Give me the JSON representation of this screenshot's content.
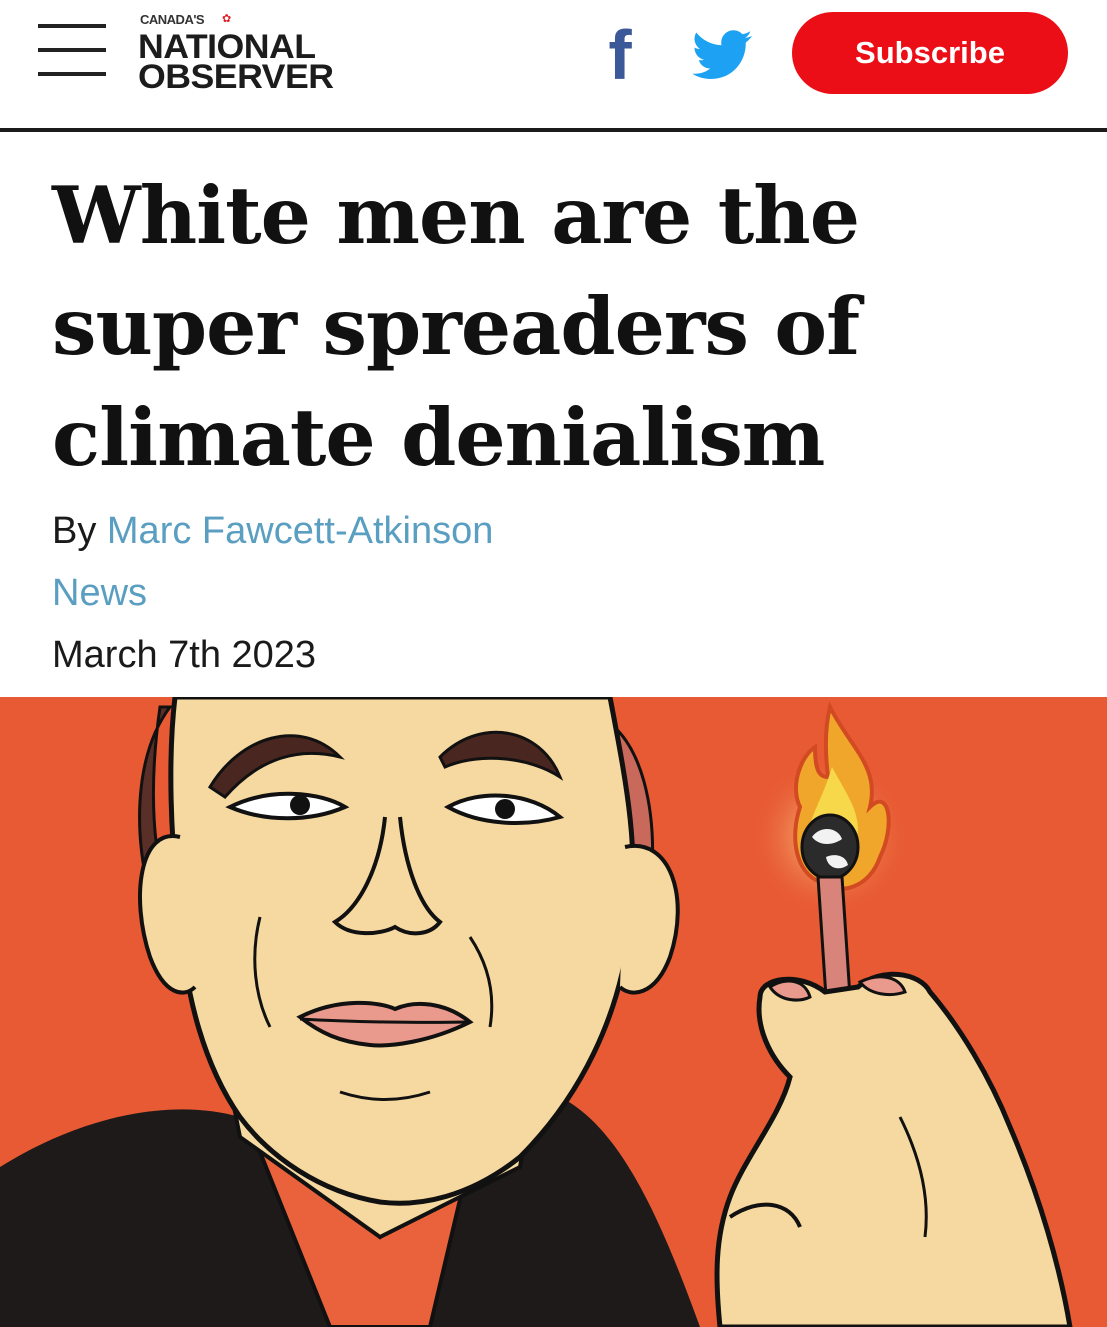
{
  "header": {
    "logo_small": "Canada's",
    "logo_line1": "NATIONAL",
    "logo_line2": "OBSERVER",
    "subscribe_label": "Subscribe"
  },
  "icons": {
    "menu": "hamburger-menu-icon",
    "facebook": "facebook-icon",
    "twitter": "twitter-icon",
    "leaf": "maple-leaf-icon"
  },
  "colors": {
    "subscribe": "#eb0e17",
    "link": "#5a9ec1",
    "facebook": "#3b5998",
    "twitter": "#1da1f2",
    "hero_background": "#e85a33"
  },
  "article": {
    "headline_line1": "White men are the",
    "headline_line2": "super spreaders of",
    "headline_line3": "climate denialism",
    "by_prefix": "By ",
    "author": "Marc Fawcett-Atkinson",
    "section": "News",
    "date": "March 7th 2023"
  }
}
